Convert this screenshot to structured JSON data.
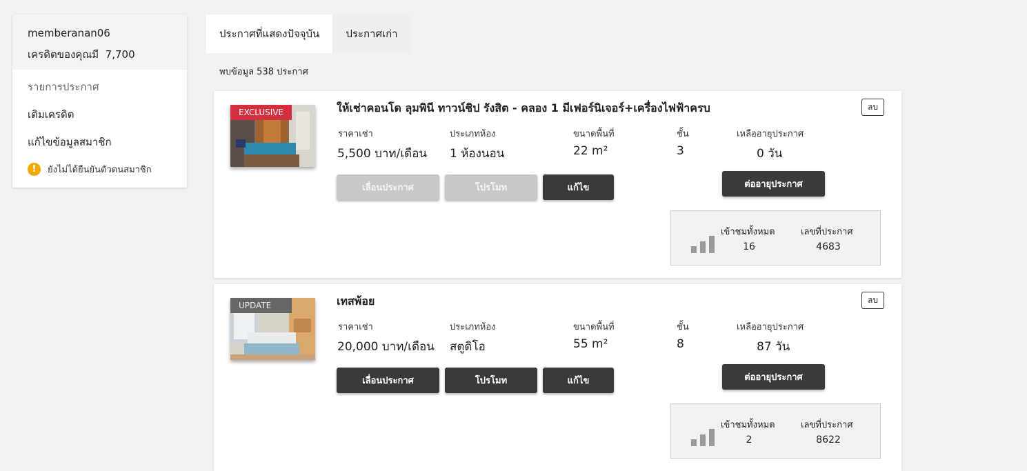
{
  "sidebar": {
    "username": "memberanan06",
    "credit_label": "เครดิตของคุณมี",
    "credit_value": "7,700",
    "menu": [
      {
        "label": "รายการประกาศ"
      },
      {
        "label": "เติมเครดิต"
      },
      {
        "label": "แก้ไขข้อมูลสมาชิก"
      }
    ],
    "warning": {
      "icon": "exclamation-circle-icon",
      "text": "ยังไม่ได้ยืนยันตัวตนสมาชิก",
      "color": "#f2a900"
    }
  },
  "tabs": [
    {
      "label": "ประกาศที่แสดงปัจจุบัน",
      "active": true
    },
    {
      "label": "ประกาศเก่า",
      "active": false
    }
  ],
  "result_count_text": "พบข้อมูล 538 ประกาศ",
  "field_labels": {
    "price": "ราคาเช่า",
    "room_type": "ประเภทห้อง",
    "area": "ขนาดพื้นที่",
    "floor": "ชั้น",
    "days_left": "เหลืออายุประกาศ",
    "views": "เข้าชมทั้งหมด",
    "listing_no": "เลขที่ประกาศ"
  },
  "buttons": {
    "delete": "ลบ",
    "boost": "เลื่อนประกาศ",
    "promote": "โปรโมท",
    "edit": "แก้ไข",
    "renew": "ต่ออายุประกาศ"
  },
  "listings": [
    {
      "badge": "EXCLUSIVE",
      "badge_color": "#d32f3f",
      "title": "ให้เช่าคอนโด ลุมพินี ทาวน์ชิป รังสิต - คลอง 1 มีเฟอร์นิเจอร์+เครื่องไฟฟ้าครบ",
      "price": "5,500 บาท/เดือน",
      "room_type": "1 ห้องนอน",
      "area": "22 m²",
      "floor": "3",
      "days_left": "0 วัน",
      "views": "16",
      "listing_no": "4683",
      "boost_enabled": false,
      "promote_enabled": false
    },
    {
      "badge": "UPDATE",
      "badge_color": "#666666",
      "title": "เทสพ้อย",
      "price": "20,000 บาท/เดือน",
      "room_type": "สตูดิโอ",
      "area": "55 m²",
      "floor": "8",
      "days_left": "87 วัน",
      "views": "2",
      "listing_no": "8622",
      "boost_enabled": true,
      "promote_enabled": true
    }
  ]
}
